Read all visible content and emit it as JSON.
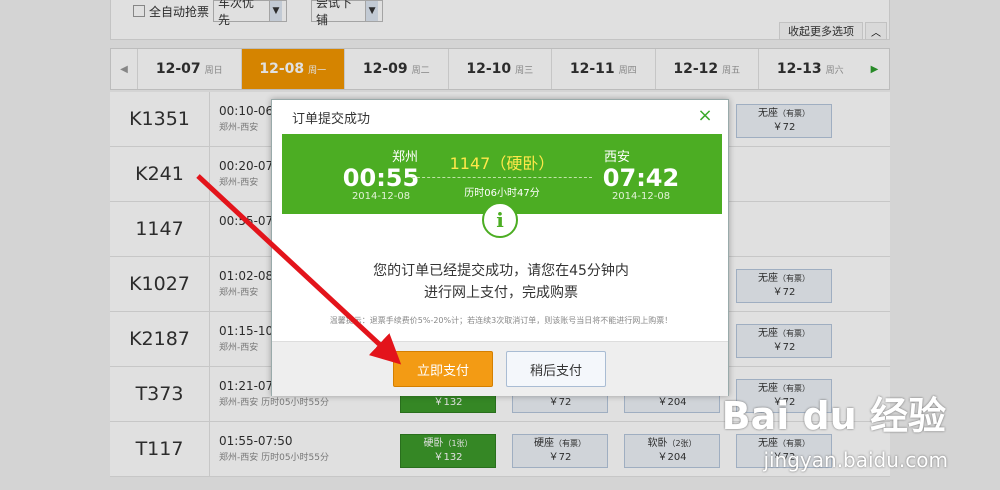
{
  "options": {
    "auto_grab_label": "全自动抢票",
    "train_priority": "车次优先",
    "berth_preference": "尝试下铺",
    "collapse_label": "收起更多选项"
  },
  "dates": [
    {
      "date": "12-07",
      "weekday": "周日"
    },
    {
      "date": "12-08",
      "weekday": "周一",
      "active": true
    },
    {
      "date": "12-09",
      "weekday": "周二"
    },
    {
      "date": "12-10",
      "weekday": "周三"
    },
    {
      "date": "12-11",
      "weekday": "周四"
    },
    {
      "date": "12-12",
      "weekday": "周五"
    },
    {
      "date": "12-13",
      "weekday": "周六"
    }
  ],
  "trains": [
    {
      "code": "K1351",
      "time": "00:10-06",
      "route": "郑州-西安",
      "seats": [
        {
          "name": "无座",
          "avail": "（有票）",
          "price": "￥72"
        }
      ]
    },
    {
      "code": "K241",
      "time": "00:20-07",
      "route": "郑州-西安",
      "seats": []
    },
    {
      "code": "1147",
      "time": "00:55-07",
      "route": "",
      "seats": []
    },
    {
      "code": "K1027",
      "time": "01:02-08",
      "route": "郑州-西安",
      "seats": [
        {
          "name": "无座",
          "avail": "（有票）",
          "price": "￥72"
        }
      ]
    },
    {
      "code": "K2187",
      "time": "01:15-10",
      "route": "郑州-西安",
      "seats": [
        {
          "name": "无座",
          "avail": "（有票）",
          "price": "￥72"
        }
      ]
    },
    {
      "code": "T373",
      "time": "01:21-07",
      "route": "郑州-西安 历时05小时55分",
      "seats": [
        {
          "name": "",
          "avail": "",
          "price": "￥132",
          "green": true
        },
        {
          "name": "",
          "avail": "",
          "price": "￥72"
        },
        {
          "name": "",
          "avail": "",
          "price": "￥204"
        },
        {
          "name": "无座",
          "avail": "（有票）",
          "price": "￥72"
        }
      ]
    },
    {
      "code": "T117",
      "time": "01:55-07:50",
      "route": "郑州-西安 历时05小时55分",
      "seats": [
        {
          "name": "硬卧",
          "avail": "（1张）",
          "price": "￥132",
          "green": true
        },
        {
          "name": "硬座",
          "avail": "（有票）",
          "price": "￥72"
        },
        {
          "name": "软卧",
          "avail": "（2张）",
          "price": "￥204"
        },
        {
          "name": "无座",
          "avail": "（有票）",
          "price": "￥72"
        }
      ]
    }
  ],
  "modal": {
    "title": "订单提交成功",
    "close": "×",
    "from_station": "郑州",
    "depart_time": "00:55",
    "depart_date": "2014-12-08",
    "train_info": "1147（硬卧）",
    "duration": "历时06小时47分",
    "to_station": "西安",
    "arrive_time": "07:42",
    "arrive_date": "2014-12-08",
    "info_symbol": "i",
    "message_line1": "您的订单已经提交成功，请您在45分钟内",
    "message_line2": "进行网上支付，完成购票",
    "tip": "温馨提示：退票手续费价5%-20%计；若连续3次取消订单，则该账号当日将不能进行网上购票！",
    "pay_now": "立即支付",
    "pay_later": "稍后支付"
  },
  "watermark": {
    "brand": "Bai du 经验",
    "url": "jingyan.baidu.com"
  },
  "colors": {
    "accent_orange": "#f39700",
    "success_green": "#4cad23",
    "arrow_red": "#e3141b"
  }
}
